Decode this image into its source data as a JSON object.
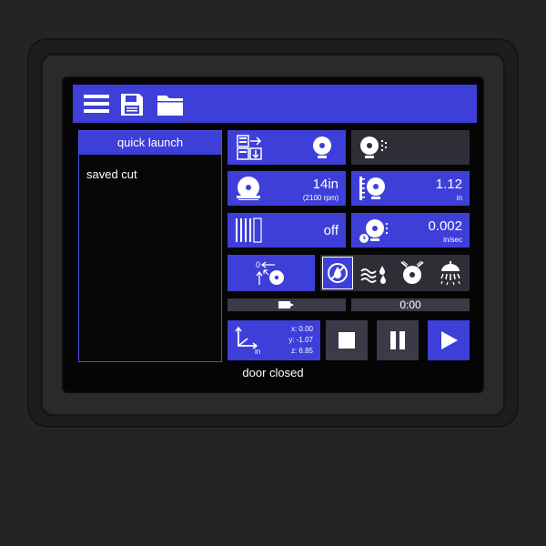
{
  "quick_launch": {
    "title": "quick launch",
    "items": [
      "saved cut"
    ]
  },
  "tiles": {
    "speed": {
      "value": "14in",
      "sub": "(2100 rpm)"
    },
    "depth": {
      "value": "1.12",
      "unit": "in"
    },
    "blade_pattern": {
      "value": "off"
    },
    "feed": {
      "value": "0.002",
      "unit": "in/sec"
    }
  },
  "timer": "0:00",
  "position": {
    "x": "x: 0.00",
    "y": "y: -1.07",
    "z": "z: 6.85",
    "unit": "in"
  },
  "status": "door closed",
  "colors": {
    "accent": "#3d3fd8",
    "dark_tile": "#2e2e36",
    "screen_bg": "#050505"
  },
  "icons": [
    "menu-icon",
    "save-icon",
    "folder-icon",
    "job-setup-icon",
    "blade-icon",
    "blade-coolant-icon",
    "blade-rpm-icon",
    "depth-icon",
    "pattern-icon",
    "feed-icon",
    "home-position-icon",
    "no-coolant-icon",
    "mist-icon",
    "spray-icon",
    "shower-icon",
    "axes-icon",
    "stop-icon",
    "pause-icon",
    "play-icon",
    "progress-marker-icon"
  ]
}
